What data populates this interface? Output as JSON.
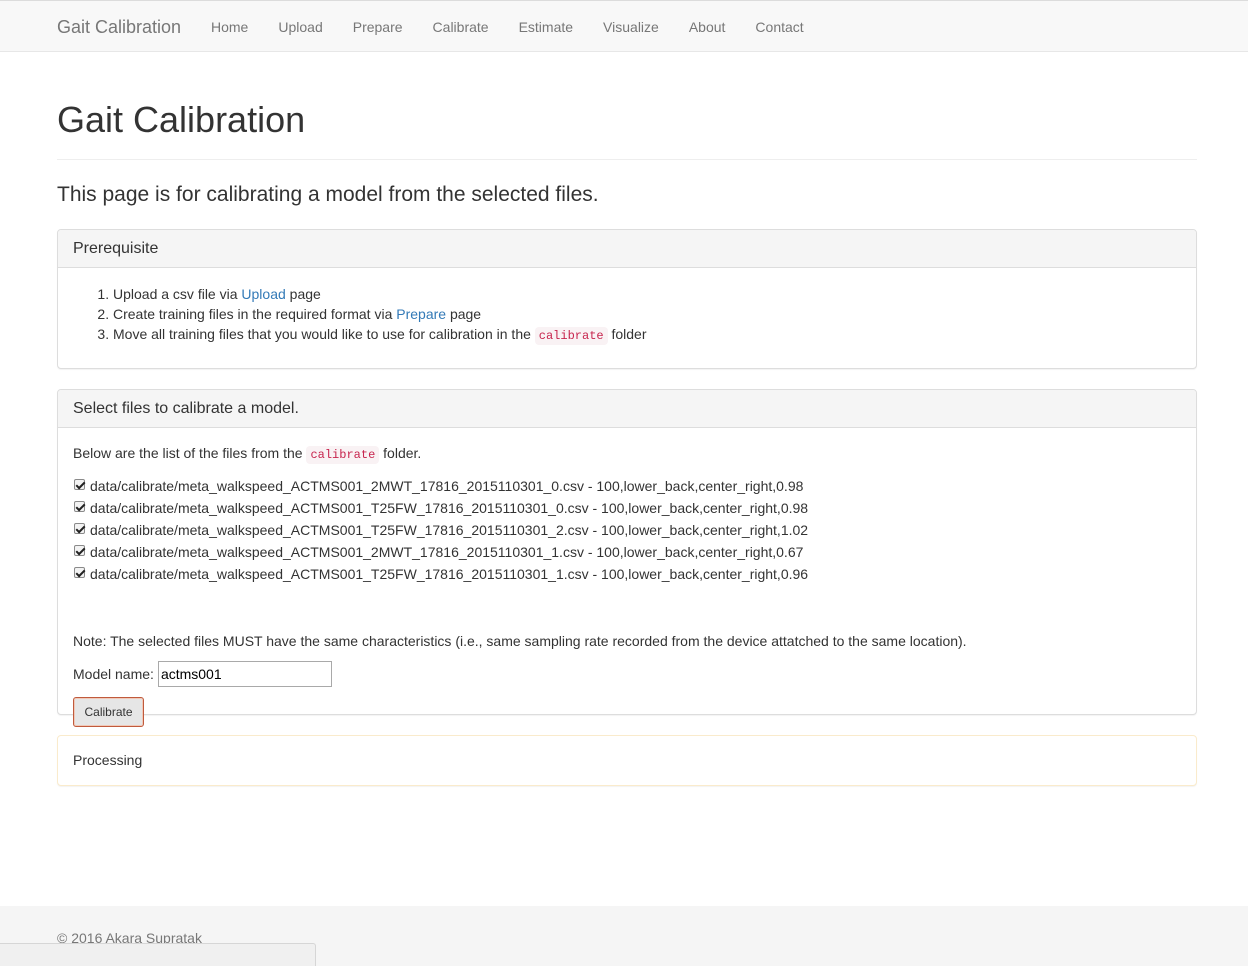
{
  "navbar": {
    "brand": "Gait Calibration",
    "items": [
      "Home",
      "Upload",
      "Prepare",
      "Calibrate",
      "Estimate",
      "Visualize",
      "About",
      "Contact"
    ]
  },
  "page": {
    "title": "Gait Calibration",
    "lead": "This page is for calibrating a model from the selected files."
  },
  "prereq": {
    "heading": "Prerequisite",
    "step1_pre": "Upload a csv file via ",
    "step1_link": "Upload",
    "step1_post": " page",
    "step2_pre": "Create training files in the required format via ",
    "step2_link": "Prepare",
    "step2_post": " page",
    "step3_pre": "Move all training files that you would like to use for calibration in the ",
    "step3_code": "calibrate",
    "step3_post": " folder"
  },
  "select": {
    "heading": "Select files to calibrate a model.",
    "desc_pre": "Below are the list of the files from the ",
    "desc_code": "calibrate",
    "desc_post": " folder.",
    "files": [
      {
        "label": "data/calibrate/meta_walkspeed_ACTMS001_2MWT_17816_2015110301_0.csv - 100,lower_back,center_right,0.98",
        "checked": true
      },
      {
        "label": "data/calibrate/meta_walkspeed_ACTMS001_T25FW_17816_2015110301_0.csv - 100,lower_back,center_right,0.98",
        "checked": true
      },
      {
        "label": "data/calibrate/meta_walkspeed_ACTMS001_T25FW_17816_2015110301_2.csv - 100,lower_back,center_right,1.02",
        "checked": true
      },
      {
        "label": "data/calibrate/meta_walkspeed_ACTMS001_2MWT_17816_2015110301_1.csv - 100,lower_back,center_right,0.67",
        "checked": true
      },
      {
        "label": "data/calibrate/meta_walkspeed_ACTMS001_T25FW_17816_2015110301_1.csv - 100,lower_back,center_right,0.96",
        "checked": true
      }
    ],
    "note": "Note: The selected files MUST have the same characteristics (i.e., same sampling rate recorded from the device attatched to the same location).",
    "model_label": "Model name:",
    "model_value": "actms001",
    "button": "Calibrate"
  },
  "processing": {
    "text": "Processing"
  },
  "footer": {
    "text": "© 2016 Akara Supratak"
  },
  "colors": {
    "link": "#337ab7",
    "code_text": "#c7254e",
    "code_bg": "#f9f2f4",
    "navbar_bg": "#f8f8f8",
    "processing_border": "#faebcc"
  }
}
